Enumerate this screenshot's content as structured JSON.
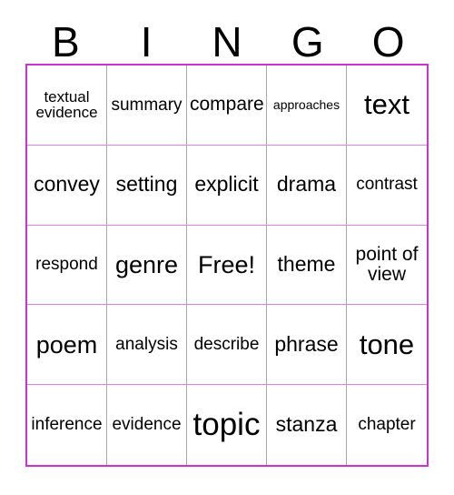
{
  "header": {
    "letters": [
      "B",
      "I",
      "N",
      "G",
      "O"
    ]
  },
  "style": {
    "outer_border_color": "#cc33cc",
    "inner_line_color": "#e27fe2",
    "text_color": "#000000",
    "background_color": "#ffffff"
  },
  "grid": {
    "columns": 5,
    "rows": 5,
    "cells": [
      {
        "text": "textual evidence",
        "size": "fs-s"
      },
      {
        "text": "summary",
        "size": "fs-m"
      },
      {
        "text": "compare",
        "size": "fs-ml"
      },
      {
        "text": "approaches",
        "size": "fs-xs"
      },
      {
        "text": "text",
        "size": "fs-xxl"
      },
      {
        "text": "convey",
        "size": "fs-l"
      },
      {
        "text": "setting",
        "size": "fs-l"
      },
      {
        "text": "explicit",
        "size": "fs-l"
      },
      {
        "text": "drama",
        "size": "fs-l"
      },
      {
        "text": "contrast",
        "size": "fs-m"
      },
      {
        "text": "respond",
        "size": "fs-m"
      },
      {
        "text": "genre",
        "size": "fs-xl"
      },
      {
        "text": "Free!",
        "size": "fs-xl"
      },
      {
        "text": "theme",
        "size": "fs-l"
      },
      {
        "text": "point of view",
        "size": "fs-ml"
      },
      {
        "text": "poem",
        "size": "fs-xl"
      },
      {
        "text": "analysis",
        "size": "fs-m"
      },
      {
        "text": "describe",
        "size": "fs-m"
      },
      {
        "text": "phrase",
        "size": "fs-l"
      },
      {
        "text": "tone",
        "size": "fs-xxl"
      },
      {
        "text": "inference",
        "size": "fs-m"
      },
      {
        "text": "evidence",
        "size": "fs-m"
      },
      {
        "text": "topic",
        "size": "fs-hg"
      },
      {
        "text": "stanza",
        "size": "fs-l"
      },
      {
        "text": "chapter",
        "size": "fs-m"
      }
    ]
  }
}
